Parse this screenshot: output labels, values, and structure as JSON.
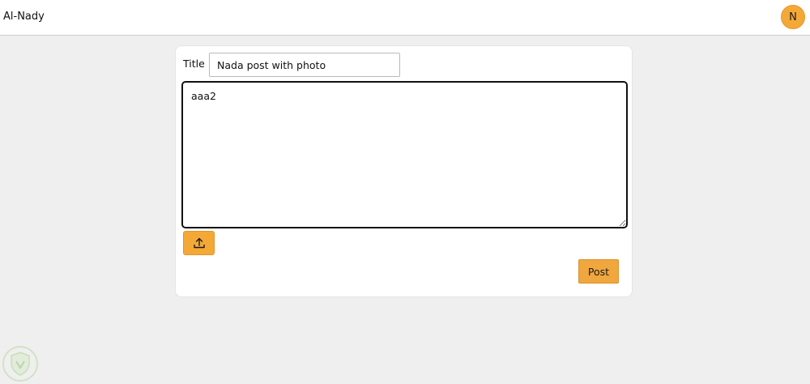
{
  "header": {
    "brand": "Al-Nady",
    "avatar_initial": "N"
  },
  "composer": {
    "title_label": "Title",
    "title_value": "Nada post with photo",
    "body_value": "aaa2",
    "upload_icon": "upload-icon",
    "post_label": "Post"
  },
  "colors": {
    "accent": "#f4a937",
    "background": "#efefef",
    "card": "#ffffff"
  }
}
